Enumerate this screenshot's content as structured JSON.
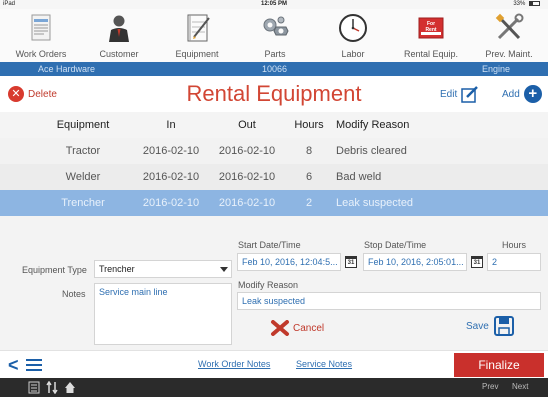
{
  "status_bar": {
    "device": "iPad",
    "time": "12:05 PM",
    "battery": "33%"
  },
  "nav": [
    {
      "label": "Work Orders",
      "icon": "work-orders-icon"
    },
    {
      "label": "Customer",
      "icon": "customer-icon"
    },
    {
      "label": "Equipment",
      "icon": "equipment-icon"
    },
    {
      "label": "Parts",
      "icon": "parts-icon"
    },
    {
      "label": "Labor",
      "icon": "labor-clock-icon"
    },
    {
      "label": "Rental Equip.",
      "icon": "rental-sign-icon",
      "sign_text": "For Rent"
    },
    {
      "label": "Prev. Maint.",
      "icon": "tools-icon"
    }
  ],
  "info_strip": {
    "customer": "Ace Hardware",
    "number": "10066",
    "category": "Engine"
  },
  "header": {
    "delete_label": "Delete",
    "title": "Rental Equipment",
    "edit_label": "Edit",
    "add_label": "Add"
  },
  "table": {
    "columns": [
      "Equipment",
      "In",
      "Out",
      "Hours",
      "Modify Reason"
    ],
    "rows": [
      {
        "equipment": "Tractor",
        "in": "2016-02-10",
        "out": "2016-02-10",
        "hours": "8",
        "reason": "Debris cleared"
      },
      {
        "equipment": "Welder",
        "in": "2016-02-10",
        "out": "2016-02-10",
        "hours": "6",
        "reason": "Bad weld"
      },
      {
        "equipment": "Trencher",
        "in": "2016-02-10",
        "out": "2016-02-10",
        "hours": "2",
        "reason": "Leak suspected"
      }
    ],
    "selected_row": 2
  },
  "form": {
    "start_label": "Start Date/Time",
    "start_value": "Feb 10, 2016, 12:04:5...",
    "stop_label": "Stop Date/Time",
    "stop_value": "Feb 10, 2016, 2:05:01...",
    "hours_label": "Hours",
    "hours_value": "2",
    "calendar_day": "31",
    "equipment_type_label": "Equipment Type",
    "equipment_type_value": "Trencher",
    "notes_label": "Notes",
    "notes_value": "Service main line",
    "modify_reason_label": "Modify Reason",
    "modify_reason_value": "Leak suspected",
    "cancel_label": "Cancel",
    "save_label": "Save"
  },
  "bottom_bar": {
    "work_order_notes": "Work Order Notes",
    "service_notes": "Service Notes",
    "finalize_label": "Finalize"
  },
  "toolbar": {
    "prev_label": "Prev",
    "next_label": "Next"
  },
  "colors": {
    "accent_blue": "#2f6fb1",
    "title_red": "#d24634",
    "finalize_red": "#c9302c",
    "selected_row": "#8db5e2"
  }
}
